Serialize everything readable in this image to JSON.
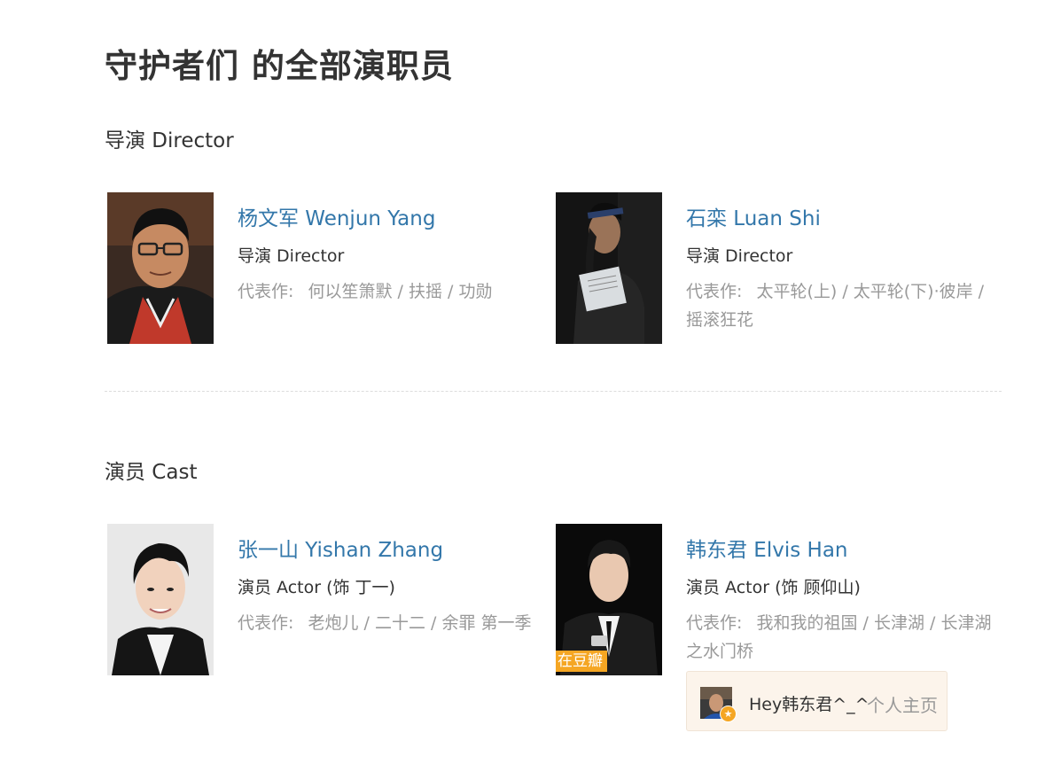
{
  "page_title": "守护者们 的全部演职员",
  "directors_section": {
    "title": "导演 Director",
    "people": [
      {
        "name": "杨文军 Wenjun Yang",
        "role": "导演 Director",
        "works_label": "代表作:",
        "works": [
          "何以笙箫默",
          "扶摇",
          "功勋"
        ]
      },
      {
        "name": "石栾 Luan Shi",
        "role": "导演 Director",
        "works_label": "代表作:",
        "works": [
          "太平轮(上)",
          "太平轮(下)·彼岸",
          "摇滚狂花"
        ]
      }
    ]
  },
  "cast_section": {
    "title": "演员 Cast",
    "people": [
      {
        "name": "张一山 Yishan Zhang",
        "role": "演员 Actor (饰 丁一)",
        "works_label": "代表作:",
        "works": [
          "老炮儿",
          "二十二",
          "余罪 第一季"
        ]
      },
      {
        "name": "韩东君 Elvis Han",
        "role": "演员 Actor (饰 顾仰山)",
        "works_label": "代表作:",
        "works": [
          "我和我的祖国",
          "长津湖",
          "长津湖之水门桥"
        ],
        "badge": "在豆瓣"
      }
    ]
  },
  "popup": {
    "greeting": "Hey韩东君^_^",
    "homepage_link": "个人主页"
  },
  "colors": {
    "link": "#3377aa",
    "text": "#333333",
    "muted": "#999999",
    "badge": "#f5a623",
    "popup_bg": "#fcf4eb"
  },
  "icons": {
    "popup_badge": "star-badge-icon"
  }
}
